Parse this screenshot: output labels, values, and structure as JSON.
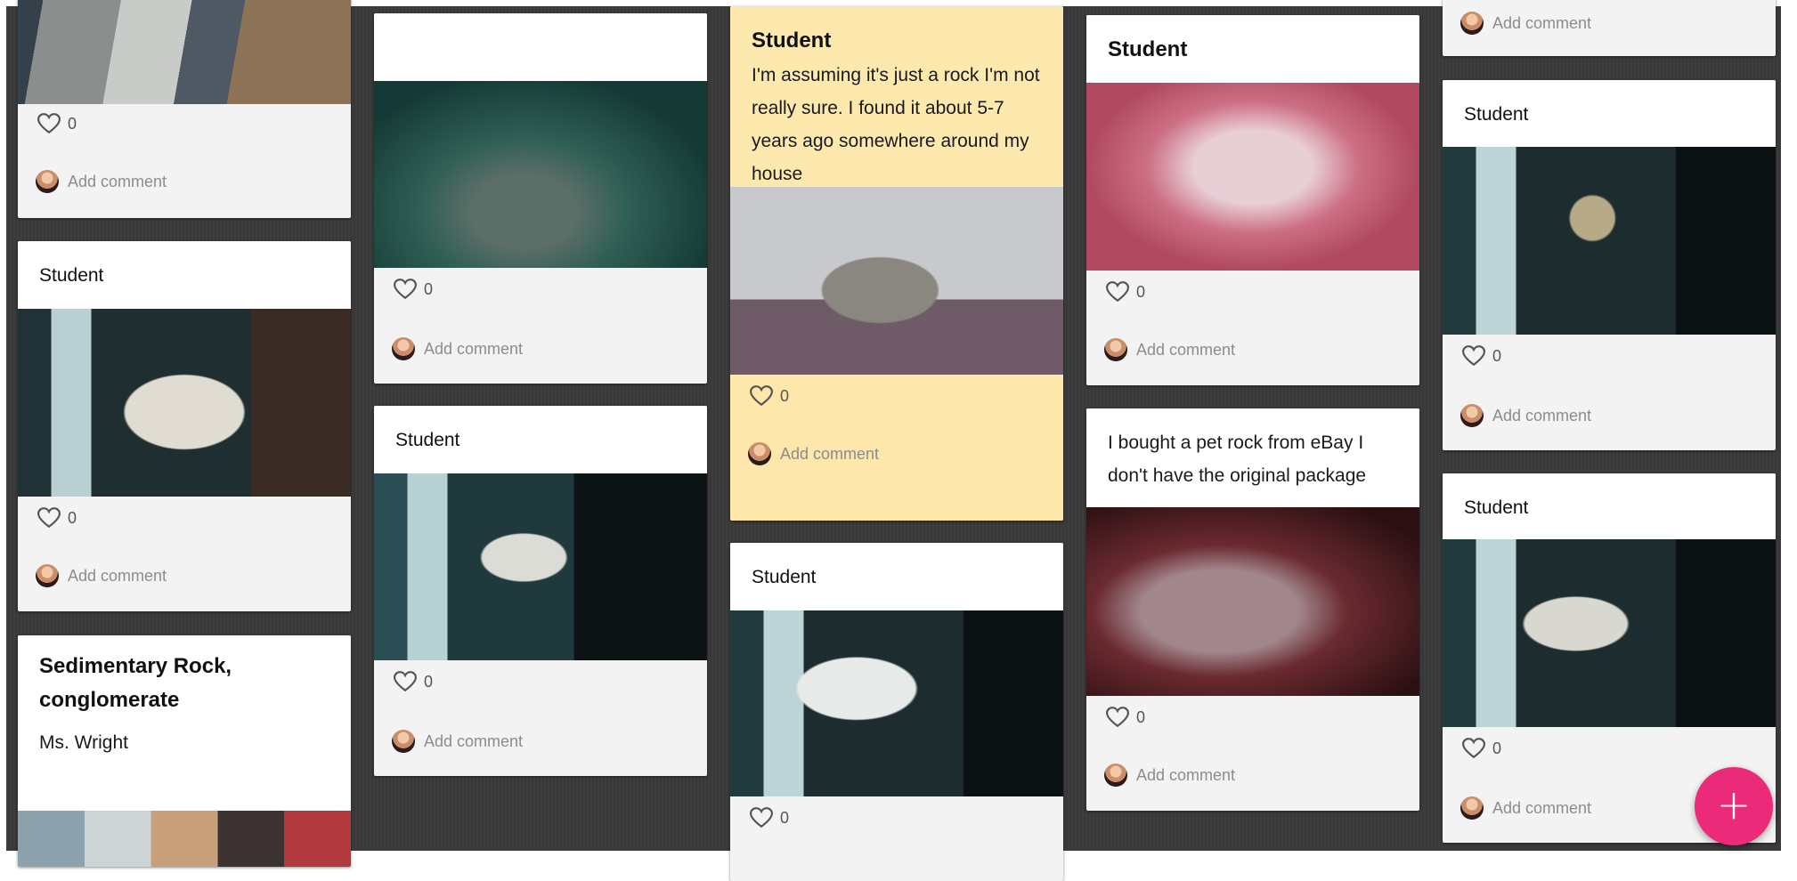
{
  "board": {
    "add_comment_label": "Add comment",
    "fab_label": "+",
    "accent_color": "#ec2a7a",
    "highlight_card_color": "#fde8ae"
  },
  "columns": [
    {
      "cards": [
        {
          "title": "",
          "body": "",
          "image": "agate specimen held by student",
          "likes": "0"
        },
        {
          "title": "Student",
          "body": "",
          "image": "rock collection box",
          "likes": "0"
        },
        {
          "title": "Sedimentary Rock, conglomerate",
          "subtitle": "Ms. Wright",
          "image": "teacher holding conglomerate rock"
        }
      ]
    },
    {
      "cards": [
        {
          "title": "",
          "body": "",
          "image": "mineral vials on carpet",
          "likes": "0"
        },
        {
          "title": "Student",
          "body": "",
          "image": "geode held by student",
          "likes": "0"
        }
      ]
    },
    {
      "cards": [
        {
          "title": "Student",
          "body": "I'm assuming it's just a rock I'm not really sure. I found it about 5-7 years ago somewhere around my house",
          "image": "heart-shaped rock",
          "likes": "0",
          "highlighted": true
        },
        {
          "title": "Student",
          "body": "",
          "image": "quartz crystal held by student",
          "likes": "0"
        }
      ]
    },
    {
      "cards": [
        {
          "title": "Student",
          "body": "",
          "image": "rose quartz in hand",
          "likes": "0"
        },
        {
          "title": "",
          "body": "I bought a pet rock from eBay I don't have the original package",
          "image": "smooth pet rock",
          "likes": "0"
        }
      ]
    },
    {
      "cards": [
        {
          "title": "",
          "body": "",
          "image": "",
          "likes": ""
        },
        {
          "title": "Student",
          "body": "",
          "image": "pyrite specimen held by student",
          "likes": "0"
        },
        {
          "title": "Student",
          "body": "",
          "image": "pumice stone held by student",
          "likes": "0"
        }
      ]
    }
  ]
}
